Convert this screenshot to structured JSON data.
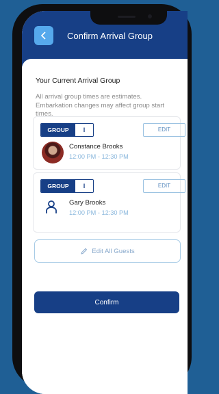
{
  "header": {
    "title": "Confirm Arrival Group",
    "back_icon": "chevron-left-icon"
  },
  "section": {
    "title": "Your Current Arrival Group",
    "description": "All arrival group times are estimates. Embarkation changes may affect group start times."
  },
  "guests": [
    {
      "group_label": "GROUP",
      "group_value": "I",
      "edit_label": "EDIT",
      "name": "Constance Brooks",
      "time": "12:00 PM - 12:30 PM",
      "avatar": "photo"
    },
    {
      "group_label": "GROUP",
      "group_value": "I",
      "edit_label": "EDIT",
      "name": "Gary Brooks",
      "time": "12:00 PM - 12:30 PM",
      "avatar": "person-icon"
    }
  ],
  "edit_all_label": "Edit All Guests",
  "confirm_label": "Confirm",
  "colors": {
    "background": "#1f5f95",
    "header": "#173f86",
    "accent": "#56a9ec",
    "time_text": "#88b6dc"
  }
}
